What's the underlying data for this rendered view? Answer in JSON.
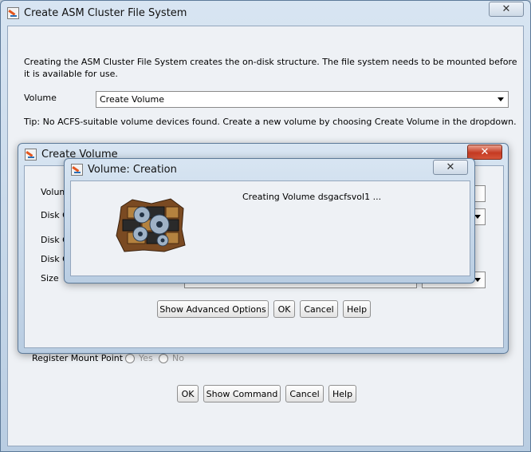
{
  "main": {
    "title": "Create ASM Cluster File System",
    "description_line1": "Creating the ASM Cluster File System creates the on-disk structure. The file system needs to be mounted before",
    "description_line2": "it is available for use.",
    "volume_label": "Volume",
    "volume_value": "Create Volume",
    "tip": "Tip: No ACFS-suitable volume devices found. Create a new volume by choosing Create Volume in the dropdown.",
    "register_label": "Register Mount Point",
    "register_yes": "Yes",
    "register_no": "No",
    "buttons": {
      "ok": "OK",
      "show_command": "Show Command",
      "cancel": "Cancel",
      "help": "Help"
    }
  },
  "create_volume": {
    "title": "Create Volume",
    "label_volume": "Volum",
    "label_disk_group": "Disk G",
    "label_disk_group_2": "Disk G",
    "label_disk_group_3": "Disk G",
    "label_size": "Size",
    "buttons": {
      "advanced": "Show Advanced Options",
      "ok": "OK",
      "cancel": "Cancel",
      "help": "Help"
    }
  },
  "volume_creation": {
    "title": "Volume: Creation",
    "message": "Creating Volume dsgacfsvol1 ..."
  },
  "icons": {
    "close": "close-icon",
    "app": "oracle-asm-icon",
    "progress": "gears-icon"
  }
}
